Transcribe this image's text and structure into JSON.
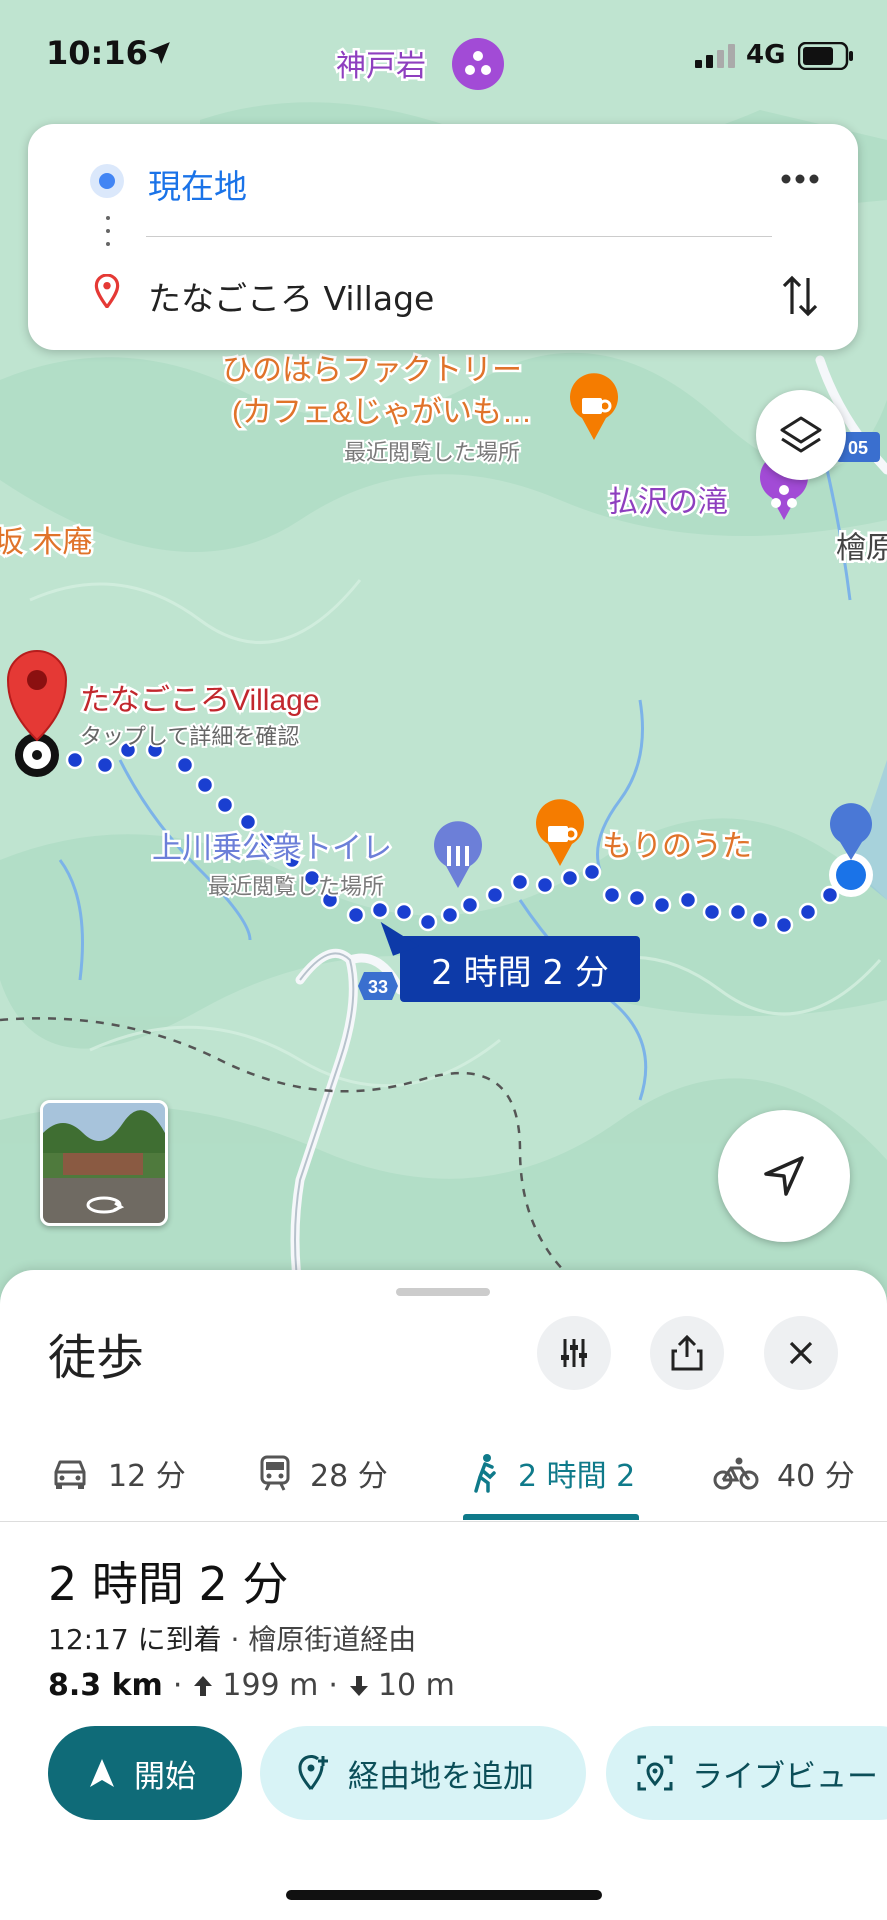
{
  "status_bar": {
    "time": "10:16",
    "network": "4G"
  },
  "directions_card": {
    "origin": "現在地",
    "destination": "たなごころ Village",
    "more_icon": "more-horizontal-icon",
    "swap_icon": "swap-vertical-icon"
  },
  "map": {
    "labels": {
      "kobeiwa": "神戸岩",
      "hinohara_factory_l1": "ひのはらファクトリー",
      "hinohara_factory_l2": "(カフェ&じゃがいも…",
      "recently_viewed_1": "最近閲覧した場所",
      "harasawa_falls": "払沢の滝",
      "hinohara_edge": "檜原",
      "road_05": "05",
      "left_edge": "坂 木庵",
      "dest_name": "たなごころVillage",
      "dest_sub": "タップして詳細を確認",
      "toilet_l1": "上川乗公衆トイレ",
      "toilet_l2": "最近閲覧した場所",
      "morinouta": "もりのうた",
      "road_33": "33"
    },
    "route_badge": "2 時間 2 分",
    "route_color": "#1a3fd0"
  },
  "sheet": {
    "title": "徒歩",
    "modes": [
      {
        "icon": "car-icon",
        "label": "12 分"
      },
      {
        "icon": "train-icon",
        "label": "28 分"
      },
      {
        "icon": "walk-icon",
        "label": "2 時間 2"
      },
      {
        "icon": "bicycle-icon",
        "label": "40 分"
      }
    ],
    "active_mode": 2,
    "duration": "2 時間 2 分",
    "arrival": "12:17 に到着",
    "via": " · 檜原街道経由",
    "distance": "8.3 km",
    "ascent": "199 m",
    "descent": "10 m",
    "actions": {
      "start": "開始",
      "add_stop": "経由地を追加",
      "live_view": "ライブビュー"
    }
  },
  "colors": {
    "accent": "#0f6b78",
    "map_green": "#bfe4d0",
    "route_blue": "#1a3fd0"
  }
}
